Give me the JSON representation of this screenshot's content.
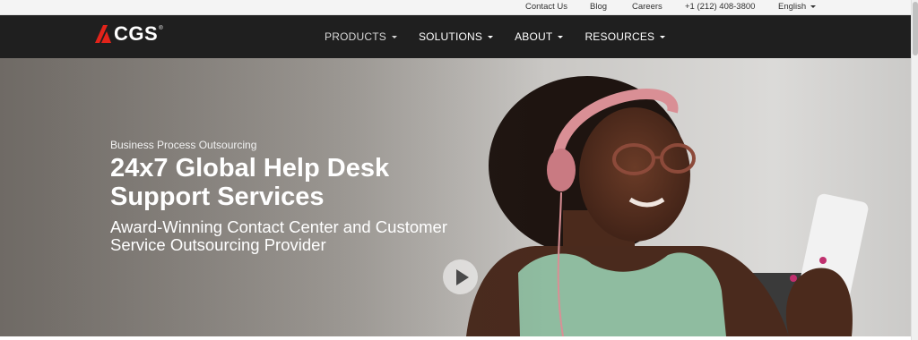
{
  "utility": {
    "contact": "Contact Us",
    "blog": "Blog",
    "careers": "Careers",
    "phone": "+1 (212) 408-3800",
    "language": "English"
  },
  "nav": {
    "logo_text": "CGS",
    "logo_reg": "®",
    "items": [
      {
        "label": "PRODUCTS"
      },
      {
        "label": "SOLUTIONS"
      },
      {
        "label": "ABOUT"
      },
      {
        "label": "RESOURCES"
      }
    ]
  },
  "hero": {
    "eyebrow": "Business Process Outsourcing",
    "headline_line1": "24x7 Global Help Desk",
    "headline_line2": "Support Services",
    "subhead_line1": "Award-Winning Contact Center and Customer",
    "subhead_line2": "Service Outsourcing Provider"
  },
  "colors": {
    "nav_bg": "#1f1f1f",
    "utility_bg": "#f4f4f4",
    "logo_red": "#e2231a",
    "headphones": "#d98f95",
    "top_green": "#8fbca0"
  },
  "icons": {
    "play": "play-icon",
    "logo_mark": "cgs-logo-mark-icon"
  }
}
